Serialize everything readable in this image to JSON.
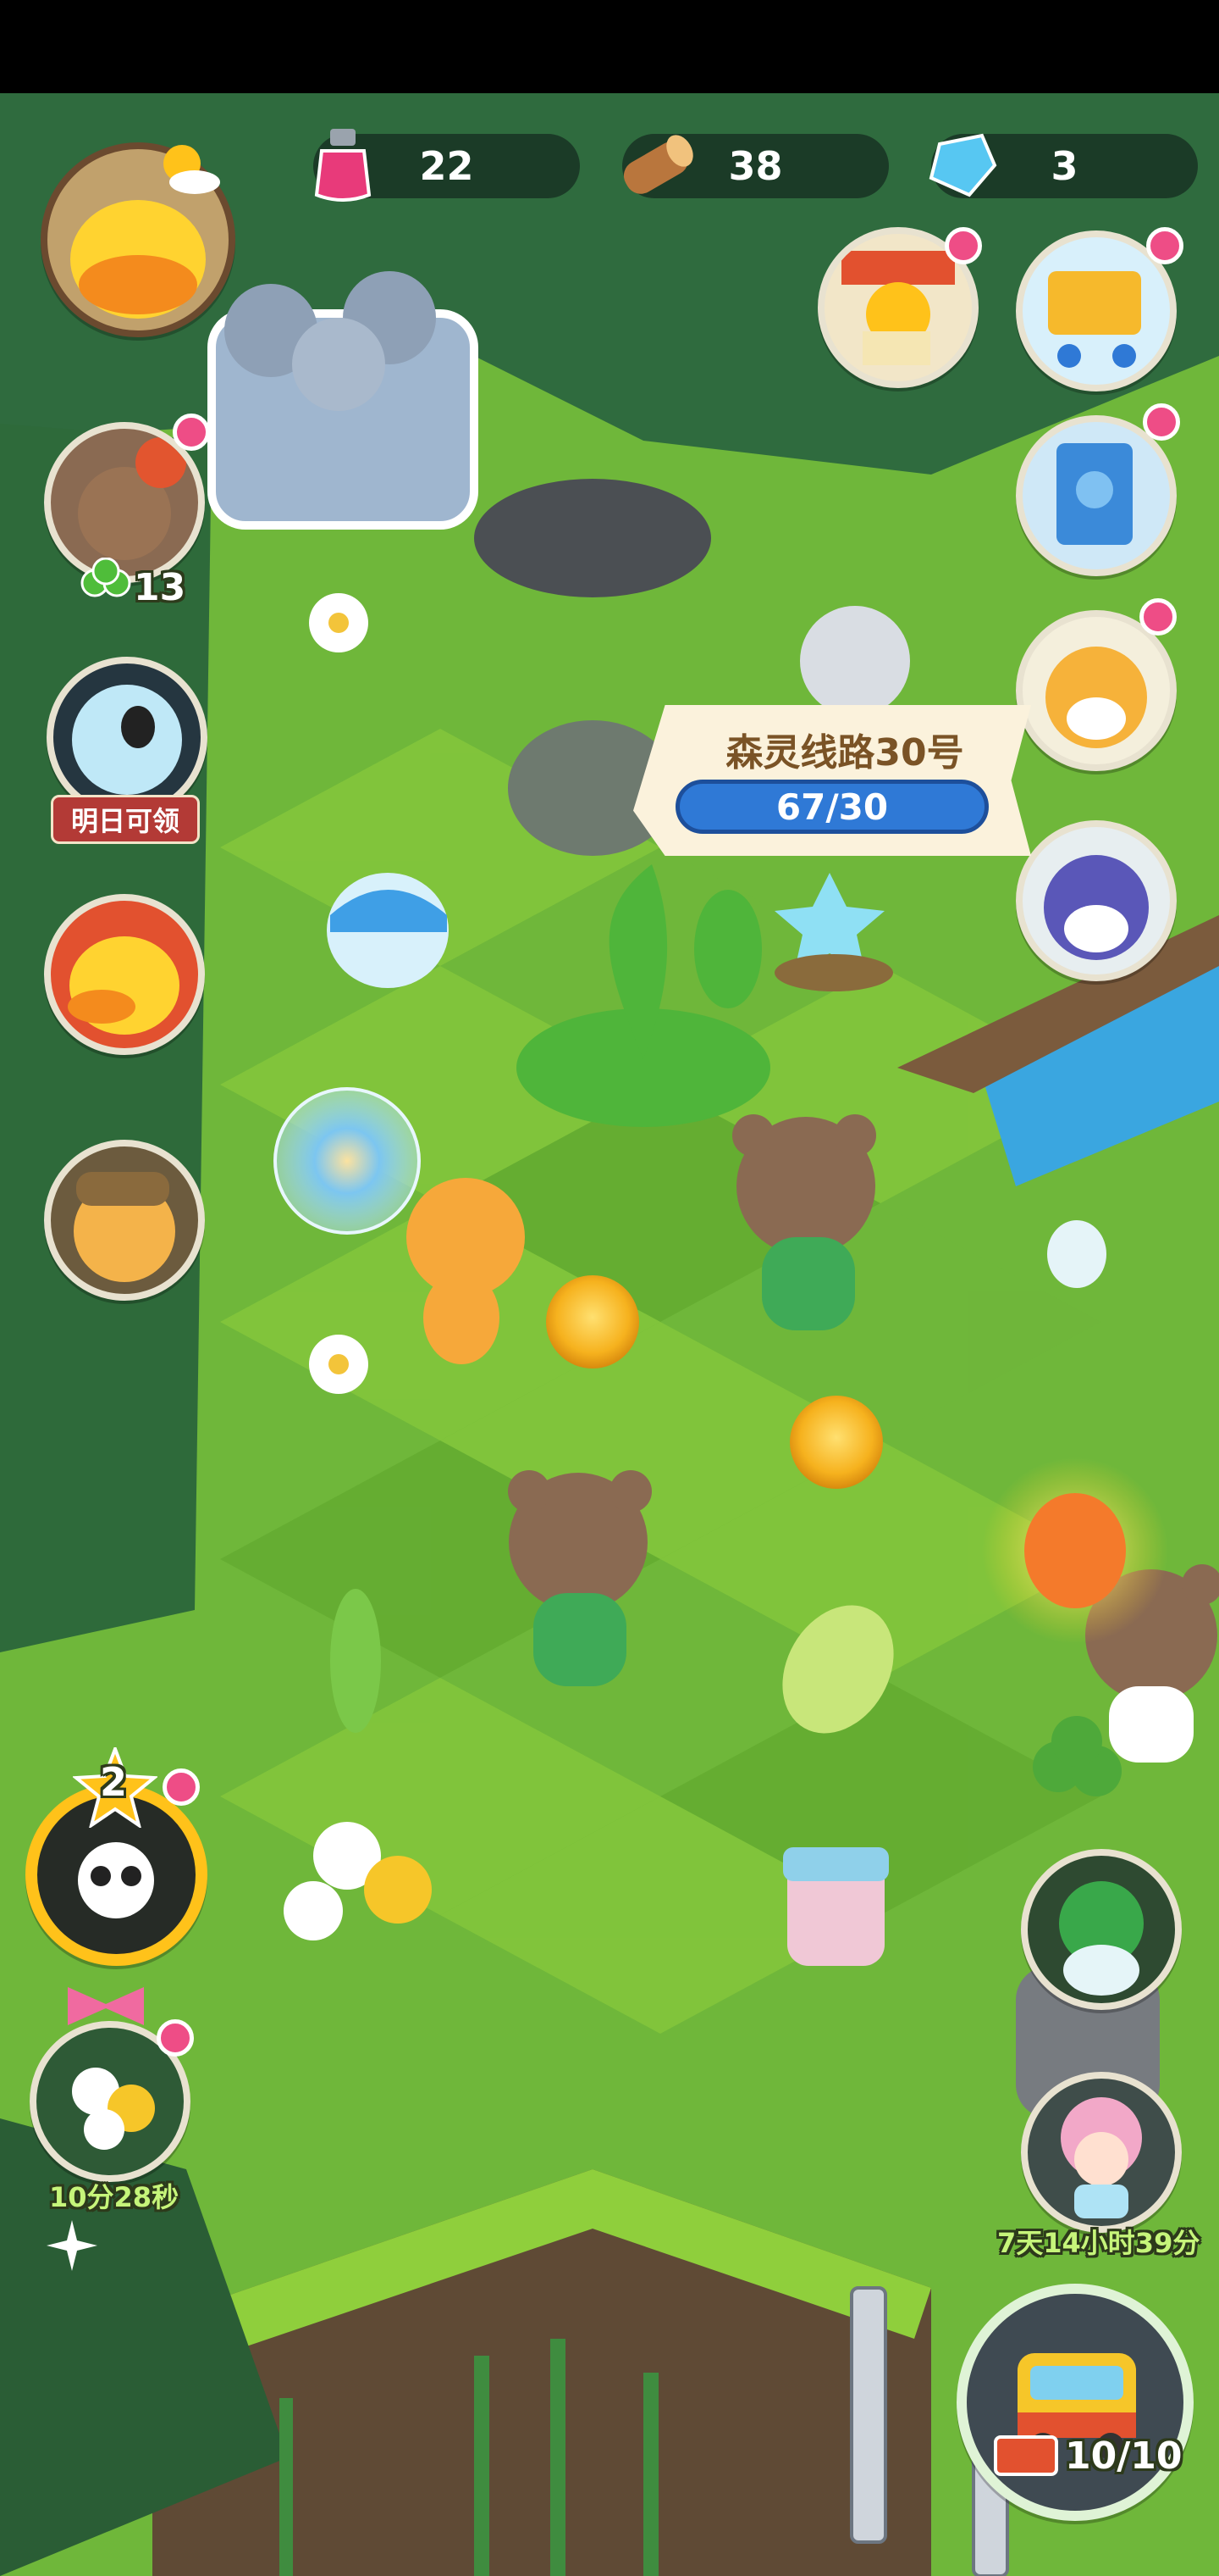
{
  "resources": {
    "potion": {
      "icon": "pink-potion-icon",
      "value": "22"
    },
    "wood": {
      "icon": "wood-log-icon",
      "value": "38"
    },
    "gem": {
      "icon": "blue-gem-icon",
      "value": "3"
    }
  },
  "left_menu": {
    "friends_count": "13",
    "daily_reward_label": "明日可领",
    "panda_level": "2",
    "flower_timer": "10分28秒"
  },
  "route_panel": {
    "title": "森灵线路30号",
    "progress": "67/30"
  },
  "right_menu": {
    "event_timer": "7天14小时39分",
    "bus_count": "10/10"
  },
  "colors": {
    "grass_light": "#8fcf3c",
    "grass_dark": "#5da52b",
    "badge_red": "#ee4d86",
    "progress_blue": "#2f79d6"
  }
}
